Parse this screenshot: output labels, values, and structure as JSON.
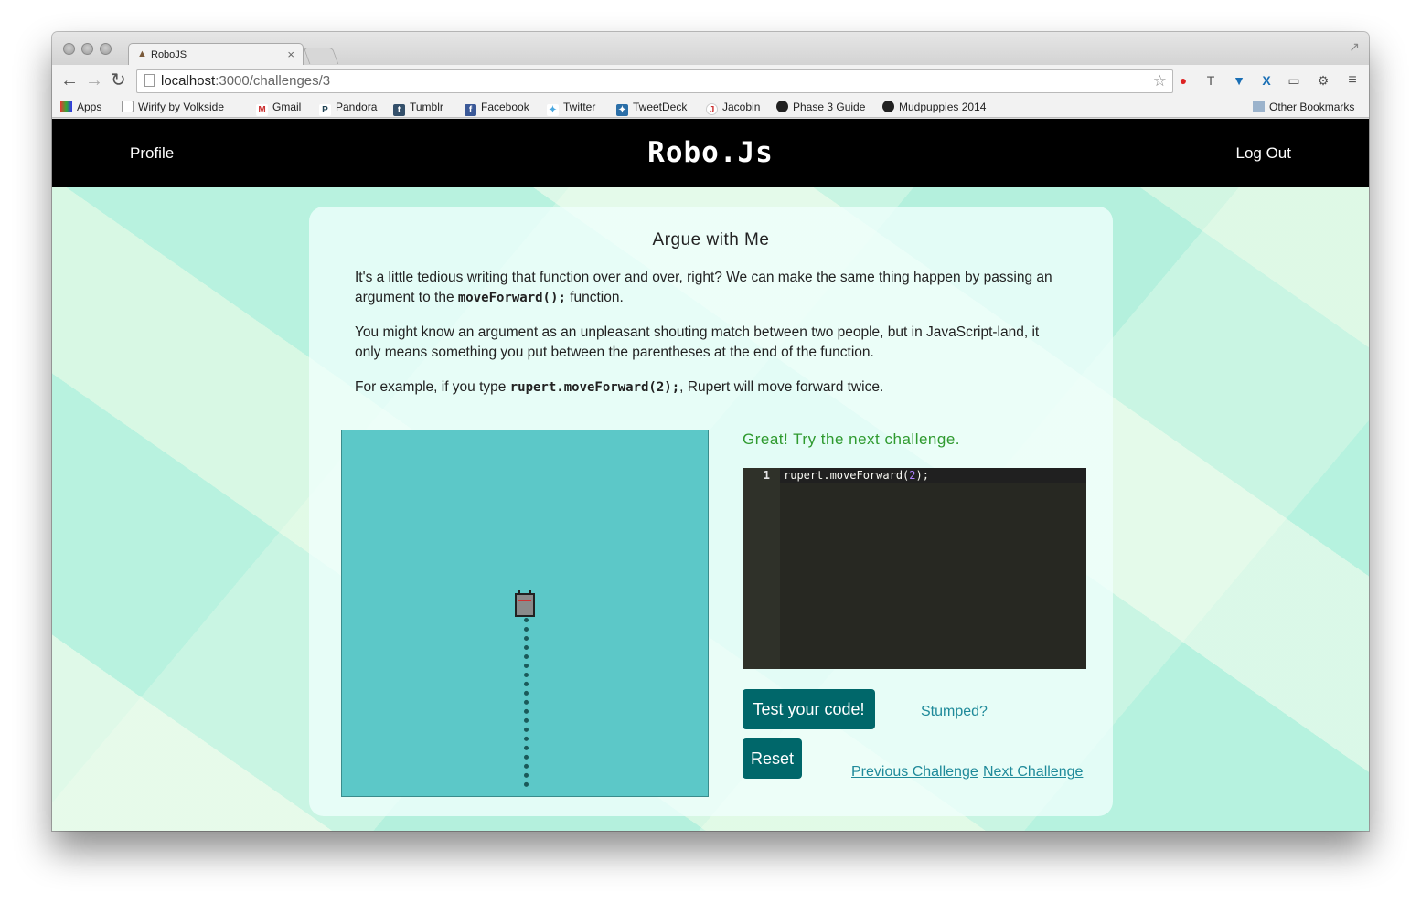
{
  "browser": {
    "tab_title": "RoboJS",
    "url_host": "localhost",
    "url_path": ":3000/challenges/3",
    "bookmarks": [
      "Apps",
      "Wirify by Volkside",
      "Gmail",
      "Pandora",
      "Tumblr",
      "Facebook",
      "Twitter",
      "TweetDeck",
      "Jacobin",
      "Phase 3 Guide",
      "Mudpuppies 2014"
    ],
    "other_bookmarks": "Other Bookmarks"
  },
  "header": {
    "profile": "Profile",
    "brand": "Robo.Js",
    "logout": "Log Out"
  },
  "challenge": {
    "title": "Argue with Me",
    "p1_a": "It's a little tedious writing that function over and over, right? We can make the same thing happen by passing an argument to the ",
    "p1_code": "moveForward();",
    "p1_b": " function.",
    "p2": "You might know an argument as an unpleasant shouting match between two people, but in JavaScript-land, it only means something you put between the parentheses at the end of the function.",
    "p3_a": "For example, if you type ",
    "p3_code": "rupert.moveForward(2);",
    "p3_b": ", Rupert will move forward twice."
  },
  "editor": {
    "line_number": "1",
    "code_pre": "rupert.moveForward(",
    "code_num": "2",
    "code_post": ");"
  },
  "status": "Great! Try the next challenge.",
  "buttons": {
    "test": "Test your code!",
    "reset": "Reset"
  },
  "links": {
    "stumped": "Stumped?",
    "previous": "Previous Challenge",
    "next": "Next Challenge"
  },
  "colors": {
    "header_bg": "#000000",
    "button_bg": "#00676a",
    "canvas_bg": "#5cc8c8",
    "status_green": "#2f9a2f",
    "link": "#1f8a9a"
  }
}
